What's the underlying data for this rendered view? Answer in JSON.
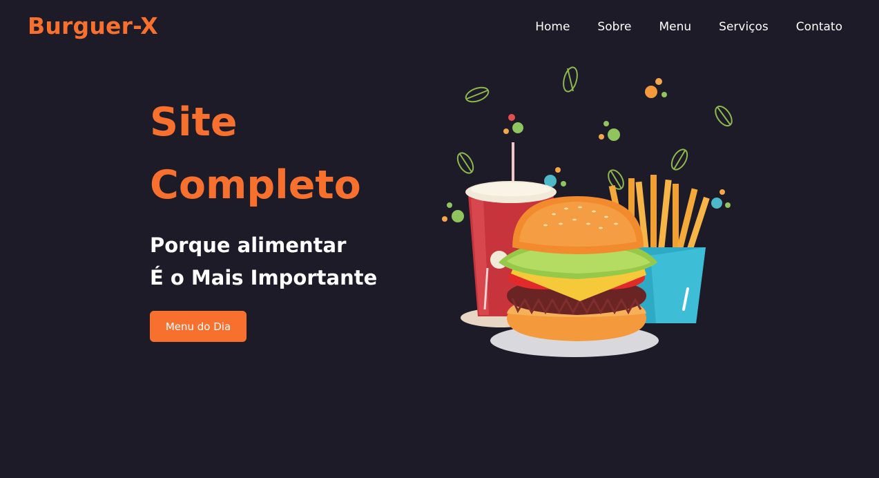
{
  "brand": {
    "name": "Burguer-X",
    "accent_color": "#f7702e",
    "background_color": "#1e1b29"
  },
  "nav": {
    "items": [
      {
        "label": "Home"
      },
      {
        "label": "Sobre"
      },
      {
        "label": "Menu"
      },
      {
        "label": "Serviços"
      },
      {
        "label": "Contato"
      }
    ]
  },
  "hero": {
    "title_line1": "Site",
    "title_line2": "Completo",
    "subtitle_line1": "Porque alimentar",
    "subtitle_line2": "É o Mais Importante",
    "button_label": "Menu do Dia",
    "illustration": "burger-combo-illustration"
  }
}
